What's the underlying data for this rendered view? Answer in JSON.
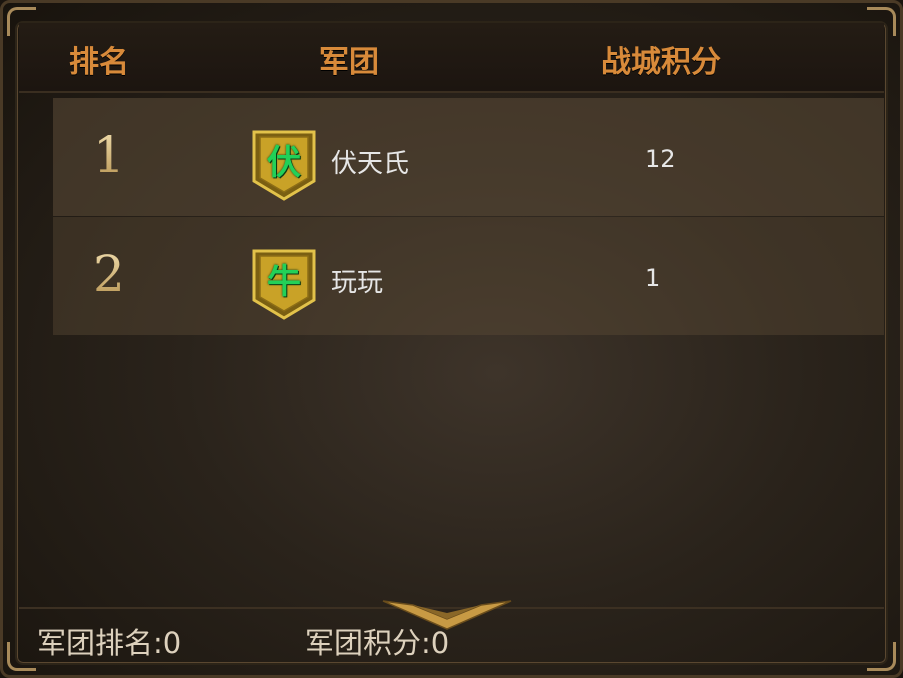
{
  "header": {
    "rank": "排名",
    "legion": "军团",
    "score": "战城积分"
  },
  "rows": [
    {
      "rank": "1",
      "badge": "伏",
      "name": "伏天氏",
      "score": "12"
    },
    {
      "rank": "2",
      "badge": "牛",
      "name": "玩玩",
      "score": "1"
    }
  ],
  "footer": {
    "my_rank": "军团排名:0",
    "my_score": "军团积分:0"
  },
  "colors": {
    "header_text": "#d88a3a",
    "badge_gold": "#c9a227",
    "badge_char": "#22d058"
  },
  "icons": {
    "badge": "shield-badge-icon",
    "expand": "chevron-down-icon"
  }
}
